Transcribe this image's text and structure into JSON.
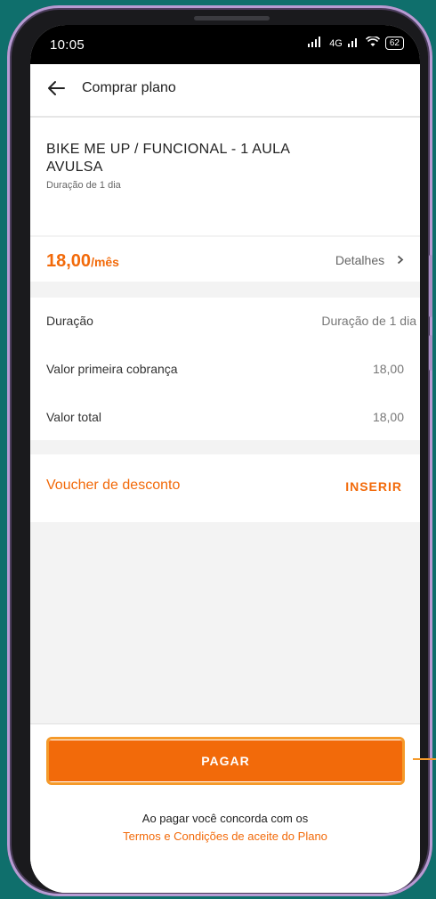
{
  "status_bar": {
    "time": "10:05",
    "network": "4G",
    "battery": "62"
  },
  "app_bar": {
    "title": "Comprar plano"
  },
  "plan": {
    "name": "BIKE ME UP / FUNCIONAL - 1 AULA AVULSA",
    "duration": "Duração de 1 dia"
  },
  "price": {
    "amount": "18,00",
    "suffix": "/mês",
    "details_label": "Detalhes"
  },
  "summary": [
    {
      "label": "Duração",
      "value": "Duração de 1 dia"
    },
    {
      "label": "Valor primeira cobrança",
      "value": "18,00"
    },
    {
      "label": "Valor total",
      "value": "18,00"
    }
  ],
  "voucher": {
    "label": "Voucher de desconto",
    "action": "INSERIR"
  },
  "footer": {
    "pay_label": "PAGAR",
    "agree_text": "Ao pagar você concorda com os",
    "terms_link": "Termos e Condições de aceite do Plano"
  },
  "colors": {
    "accent": "#f26a0a",
    "highlight": "#f59a2a",
    "background": "#0f6f6c"
  }
}
